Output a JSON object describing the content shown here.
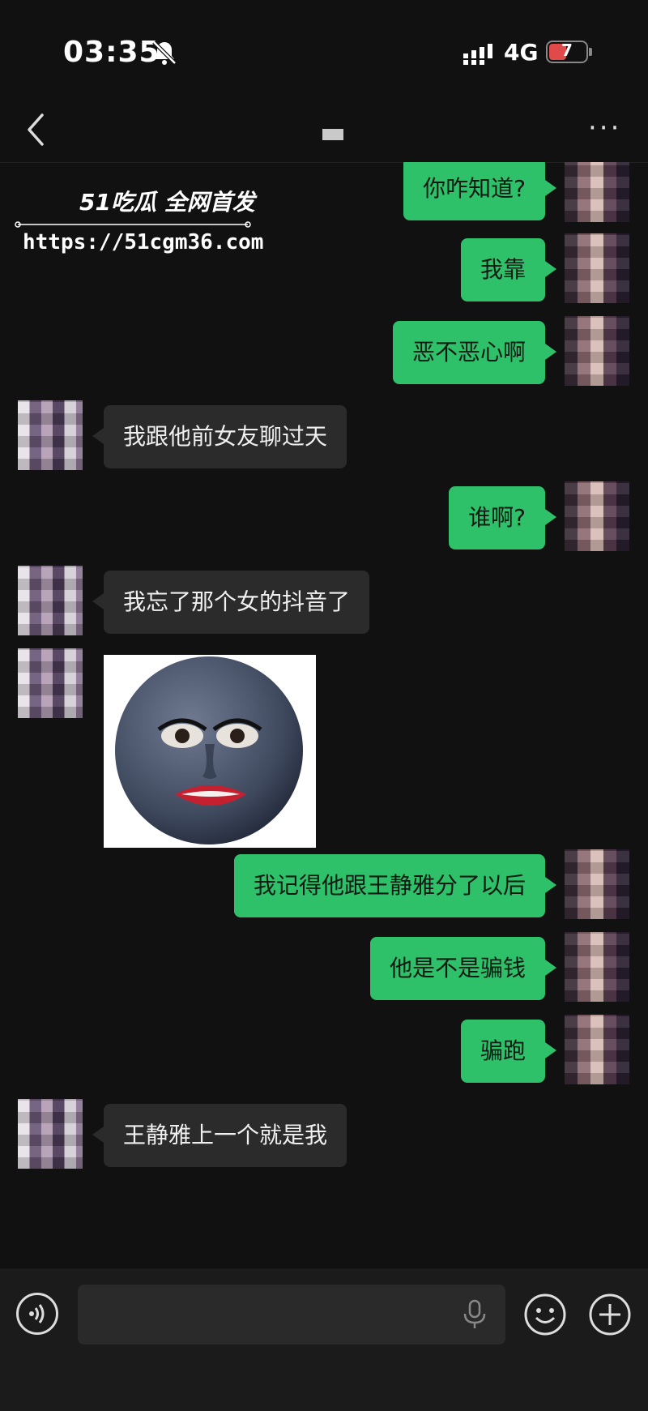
{
  "status_bar": {
    "time": "03:35",
    "network": "4G",
    "battery": "7"
  },
  "header": {
    "back_icon": "chevron-left-icon",
    "more_label": "···"
  },
  "watermark": {
    "brand": "51吃瓜 全网首发",
    "url": "https://51cgm36.com"
  },
  "messages": [
    {
      "side": "me",
      "text": "你咋知道?"
    },
    {
      "side": "me",
      "text": "我靠"
    },
    {
      "side": "me",
      "text": "恶不恶心啊"
    },
    {
      "side": "other",
      "text": "我跟他前女友聊过天"
    },
    {
      "side": "me",
      "text": "谁啊?"
    },
    {
      "side": "other",
      "text": "我忘了那个女的抖音了"
    },
    {
      "side": "other",
      "type": "sticker"
    },
    {
      "side": "me",
      "text": "我记得他跟王静雅分了以后"
    },
    {
      "side": "me",
      "text": "他是不是骗钱"
    },
    {
      "side": "me",
      "text": "骗跑"
    },
    {
      "side": "other",
      "text": "王静雅上一个就是我"
    }
  ],
  "input_bar": {
    "voice_icon": "voice-icon",
    "mic_icon": "mic-icon",
    "emoji_icon": "emoji-icon",
    "plus_icon": "plus-icon"
  },
  "colors": {
    "background": "#111111",
    "bubble_me": "#2ec16a",
    "bubble_other": "#2b2b2b"
  }
}
